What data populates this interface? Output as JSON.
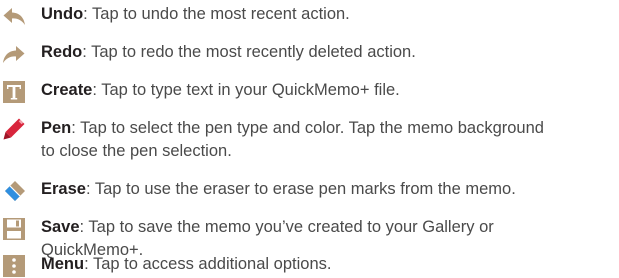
{
  "items": [
    {
      "icon": "undo-icon",
      "term": "Undo",
      "lines": [
        ": Tap to undo the most recent action."
      ]
    },
    {
      "icon": "redo-icon",
      "term": "Redo",
      "lines": [
        ": Tap to redo the most recently deleted action."
      ]
    },
    {
      "icon": "create-text-icon",
      "term": "Create",
      "lines": [
        ": Tap to type text in your QuickMemo+ file."
      ]
    },
    {
      "icon": "pen-icon",
      "term": "Pen",
      "lines": [
        ": Tap to select the pen type and color. Tap the memo background",
        "to close the pen selection."
      ]
    },
    {
      "icon": "eraser-icon",
      "term": "Erase",
      "lines": [
        ": Tap to use the eraser to erase pen marks from the memo."
      ]
    },
    {
      "icon": "save-icon",
      "term": "Save",
      "lines": [
        ": Tap to save the memo you’ve created to your Gallery or",
        "QuickMemo+."
      ]
    },
    {
      "icon": "menu-icon",
      "term": "Menu",
      "lines": [
        ": Tap to access additional options."
      ]
    }
  ],
  "colors": {
    "icon_tan": "#b49a78",
    "icon_tan_dark": "#8f7656",
    "pen_red": "#d8253c",
    "text": "#4a4a4a",
    "term": "#231f20"
  }
}
